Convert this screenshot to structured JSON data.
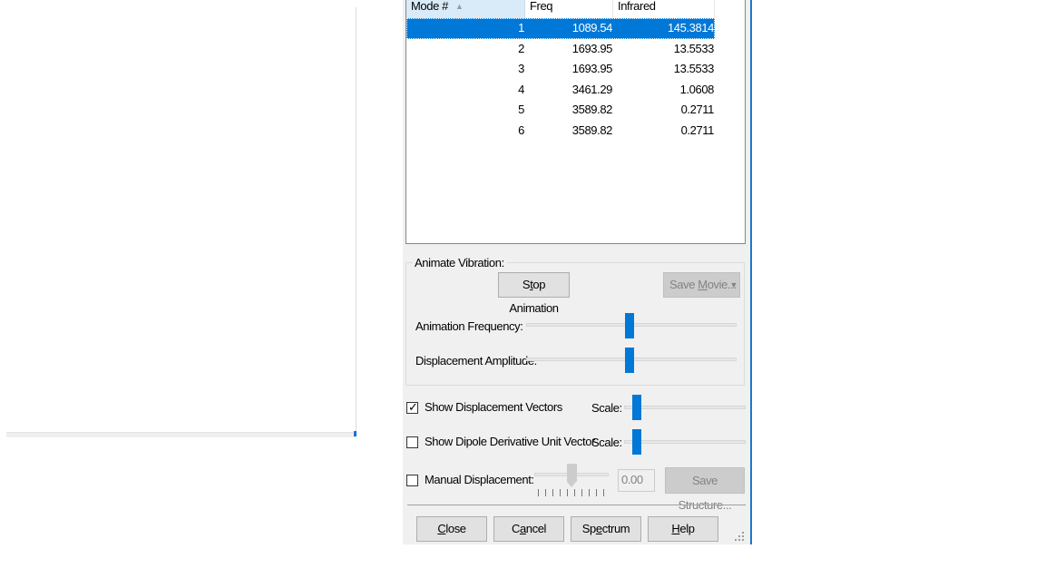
{
  "table": {
    "headers": {
      "mode": "Mode #",
      "freq": "Freq",
      "infrared": "Infrared"
    },
    "rows": [
      {
        "mode": "1",
        "freq": "1089.54",
        "infrared": "145.3814",
        "selected": true
      },
      {
        "mode": "2",
        "freq": "1693.95",
        "infrared": "13.5533"
      },
      {
        "mode": "3",
        "freq": "1693.95",
        "infrared": "13.5533"
      },
      {
        "mode": "4",
        "freq": "3461.29",
        "infrared": "1.0608"
      },
      {
        "mode": "5",
        "freq": "3589.82",
        "infrared": "0.2711"
      },
      {
        "mode": "6",
        "freq": "3589.82",
        "infrared": "0.2711"
      }
    ]
  },
  "animate": {
    "group_title": "Animate Vibration:",
    "stop_pre": "S",
    "stop_u": "t",
    "stop_post": "op Animation",
    "save_movie_pre": "Save ",
    "save_movie_u": "M",
    "save_movie_post": "ovie...",
    "frequency_label": "Animation Frequency:",
    "amplitude_label": "Displacement Amplitude:",
    "frequency_level": 0.49,
    "amplitude_level": 0.49
  },
  "options": {
    "show_vectors_label": "Show Displacement Vectors",
    "show_vectors_checked": true,
    "show_dipole_label": "Show Dipole Derivative Unit Vector",
    "show_dipole_checked": false,
    "scale_label": "Scale:",
    "manual_label": "Manual Displacement:",
    "manual_checked": false,
    "manual_value": "0.00",
    "save_structure": "Save Structure..."
  },
  "buttons": {
    "close_u": "C",
    "close_post": "lose",
    "cancel_pre": "C",
    "cancel_u": "a",
    "cancel_post": "ncel",
    "spectrum_pre": "Sp",
    "spectrum_u": "e",
    "spectrum_post": "ctrum",
    "help_u": "H",
    "help_post": "elp"
  },
  "colors": {
    "selection": "#0078d7",
    "accent": "#1979ca"
  },
  "icons": {
    "sort": "sort-ascending-icon",
    "check": "checkmark-icon",
    "dropdown": "dropdown-arrow-icon",
    "grip": "resize-grip-icon"
  }
}
